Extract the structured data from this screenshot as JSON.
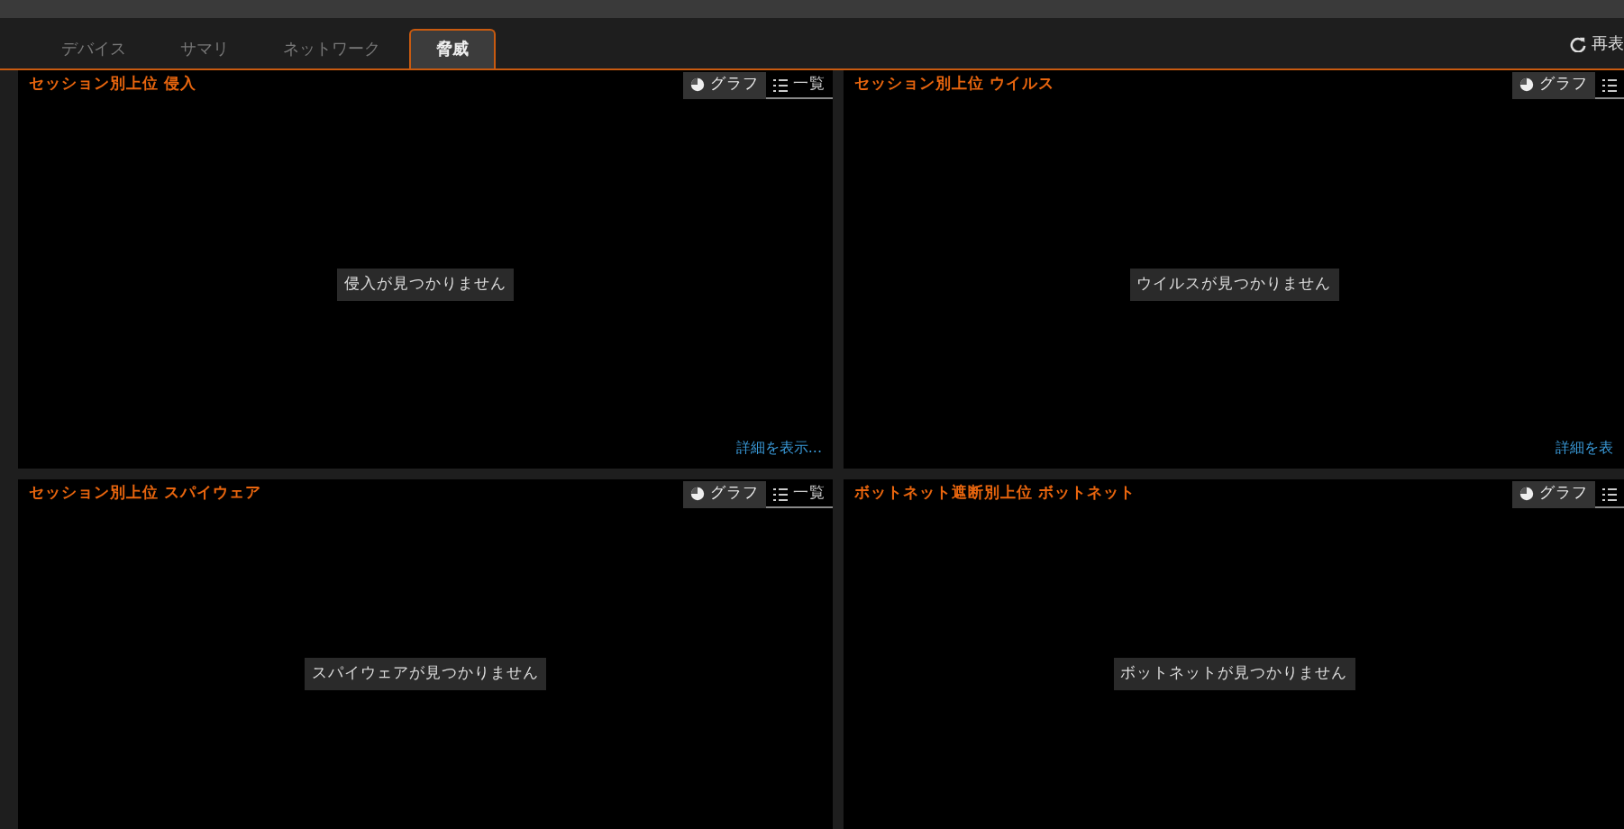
{
  "tabs": [
    {
      "label": "デバイス",
      "selected": false
    },
    {
      "label": "サマリ",
      "selected": false
    },
    {
      "label": "ネットワーク",
      "selected": false
    },
    {
      "label": "脅威",
      "selected": true
    }
  ],
  "refresh": {
    "label": "再表"
  },
  "panels": [
    {
      "title": "セッション別上位 侵入",
      "views": [
        {
          "label": "グラフ",
          "selected": true
        },
        {
          "label": "一覧",
          "selected": false
        }
      ],
      "empty": "侵入が見つかりません",
      "link": "詳細を表示..."
    },
    {
      "title": "セッション別上位 ウイルス",
      "views": [
        {
          "label": "グラフ",
          "selected": true
        },
        {
          "selected": false
        }
      ],
      "empty": "ウイルスが見つかりません",
      "link": "詳細を表"
    },
    {
      "title": "セッション別上位 スパイウェア",
      "views": [
        {
          "label": "グラフ",
          "selected": true
        },
        {
          "label": "一覧",
          "selected": false
        }
      ],
      "empty": "スパイウェアが見つかりません"
    },
    {
      "title": "ボットネット遮断別上位 ボットネット",
      "views": [
        {
          "label": "グラフ",
          "selected": true
        },
        {
          "selected": false
        }
      ],
      "empty": "ボットネットが見つかりません"
    }
  ]
}
